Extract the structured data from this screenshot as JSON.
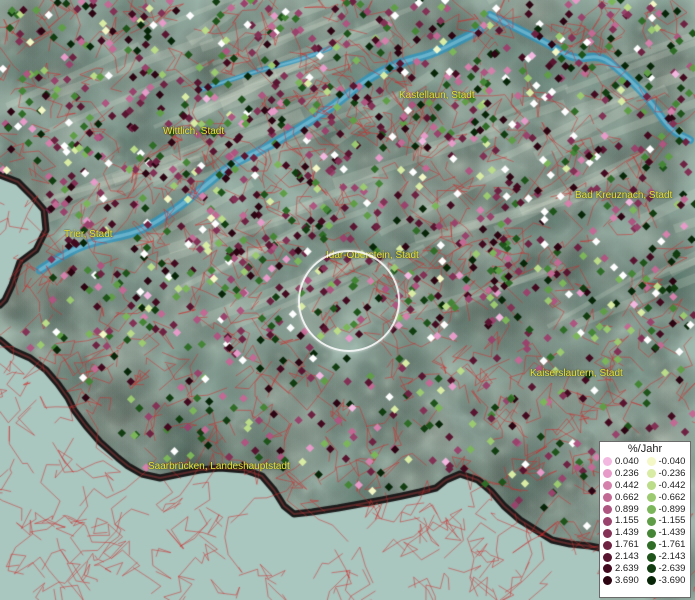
{
  "map": {
    "cities": [
      {
        "name": "Kastellaun, Stadt"
      },
      {
        "name": "Wittlich, Stadt"
      },
      {
        "name": "Bad Kreuznach, Stadt"
      },
      {
        "name": "Trier, Stadt"
      },
      {
        "name": "Idar-Oberstein, Stadt"
      },
      {
        "name": "Kaiserslautern, Stadt"
      },
      {
        "name": "Saarbrücken, Landeshauptstadt"
      }
    ],
    "colors": {
      "terrain": "#9fb8ad",
      "rivers": "#3a9ec4",
      "borders": "#d02a2a",
      "outside_area": "#a9c6bf",
      "state_border": "#1a1a1a"
    }
  },
  "legend": {
    "title": "%/Jahr",
    "positive": [
      {
        "label": "0.040",
        "color": "#f3b8e0"
      },
      {
        "label": "0.236",
        "color": "#e69bc8"
      },
      {
        "label": "0.442",
        "color": "#d481ab"
      },
      {
        "label": "0.662",
        "color": "#c26a94"
      },
      {
        "label": "0.899",
        "color": "#ae5580"
      },
      {
        "label": "1.155",
        "color": "#99436c"
      },
      {
        "label": "1.439",
        "color": "#833155"
      },
      {
        "label": "1.761",
        "color": "#6e2242"
      },
      {
        "label": "2.143",
        "color": "#591530"
      },
      {
        "label": "2.639",
        "color": "#430a1f"
      },
      {
        "label": "3.690",
        "color": "#2c0412"
      }
    ],
    "negative": [
      {
        "label": "-0.040",
        "color": "#f4f8c6"
      },
      {
        "label": "-0.236",
        "color": "#d9eca4"
      },
      {
        "label": "-0.442",
        "color": "#bbdc88"
      },
      {
        "label": "-0.662",
        "color": "#9bca70"
      },
      {
        "label": "-0.899",
        "color": "#7cb65a"
      },
      {
        "label": "-1.155",
        "color": "#5f9e46"
      },
      {
        "label": "-1.439",
        "color": "#458636"
      },
      {
        "label": "-1.761",
        "color": "#2f6d27"
      },
      {
        "label": "-2.143",
        "color": "#1e541a"
      },
      {
        "label": "-2.639",
        "color": "#113d10"
      },
      {
        "label": "-3.690",
        "color": "#072608"
      }
    ]
  }
}
